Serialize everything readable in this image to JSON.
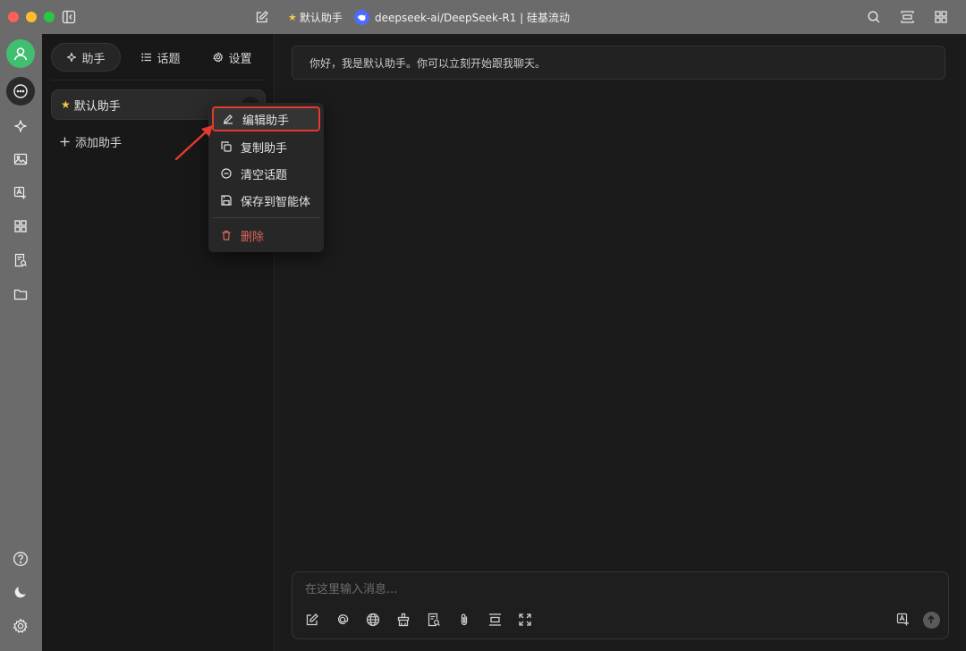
{
  "window": {
    "assistant_chip": "默认助手",
    "model_title": "deepseek-ai/DeepSeek-R1 | 硅基流动",
    "accent": "#3fbf6f"
  },
  "rail": {
    "items": [
      "avatar",
      "chat",
      "agents",
      "image",
      "translate",
      "apps",
      "knowledge",
      "files"
    ],
    "bottom": [
      "help",
      "theme",
      "settings"
    ]
  },
  "sidebar": {
    "tabs": [
      {
        "label": "助手"
      },
      {
        "label": "话题"
      },
      {
        "label": "设置"
      }
    ],
    "assistant_name": "默认助手",
    "add_assistant": "添加助手"
  },
  "context_menu": {
    "items": [
      {
        "label": "编辑助手"
      },
      {
        "label": "复制助手"
      },
      {
        "label": "清空话题"
      },
      {
        "label": "保存到智能体"
      },
      {
        "label": "删除"
      }
    ],
    "danger_color": "#e0655a",
    "highlight_color": "#e23a2d"
  },
  "chat": {
    "greeting": "你好，我是默认助手。你可以立刻开始跟我聊天。",
    "input_placeholder": "在这里输入消息..."
  }
}
